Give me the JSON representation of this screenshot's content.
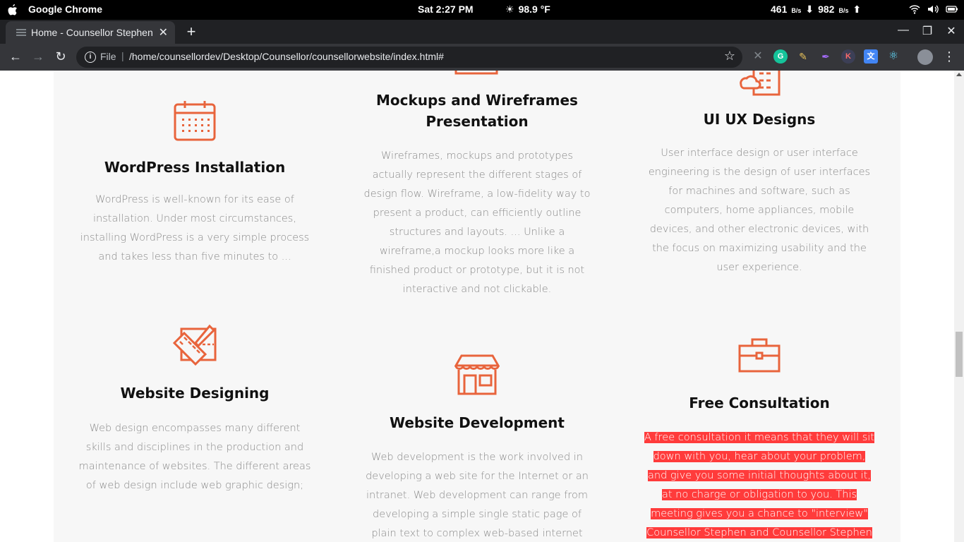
{
  "os": {
    "app_name": "Google Chrome",
    "clock": "Sat  2:27 PM",
    "weather": "98.9 °F",
    "net_down": "461",
    "net_down_unit": "B/s",
    "net_up": "982",
    "net_up_unit": "B/s"
  },
  "browser": {
    "tab_title": "Home - Counsellor Stephen",
    "new_tab": "+",
    "scheme": "File",
    "url": "/home/counsellordev/Desktop/Counsellor/counsellorwebsite/index.html#"
  },
  "colors": {
    "accent": "#e8643c",
    "highlight": "#ff3b3b"
  },
  "services": [
    {
      "title": "WordPress Installation",
      "icon": "calendar-icon",
      "text": "WordPress is well-known for its ease of installation. Under most circumstances, installing WordPress is a very simple process and takes less than five minutes to ..."
    },
    {
      "title": "Mockups and Wireframes Presentation",
      "icon": "wireframe-icon",
      "text": "Wireframes, mockups and prototypes actually represent the different stages of design flow. Wireframe, a low-fidelity way to present a product, can efficiently outline structures and layouts. ... Unlike a wireframe,a mockup looks more like a finished product or prototype, but it is not interactive and not clickable."
    },
    {
      "title": "UI UX Designs",
      "icon": "cloud-building-icon",
      "text": "User interface design or user interface engineering is the design of user interfaces for machines and software, such as computers, home appliances, mobile devices, and other electronic devices, with the focus on maximizing usability and the user experience."
    },
    {
      "title": "Website Designing",
      "icon": "design-tools-icon",
      "text": "Web design encompasses many different skills and disciplines in the production and maintenance of websites. The different areas of web design include web graphic design;"
    },
    {
      "title": "Website Development",
      "icon": "storefront-icon",
      "text": "Web development is the work involved in developing a web site for the Internet or an intranet. Web development can range from developing a simple single static page of plain text to complex web-based internet"
    },
    {
      "title": "Free Consultation",
      "icon": "briefcase-icon",
      "text": "A free consultation it means that they will sit down with you, hear about your problem, and give you some initial thoughts about it, at no charge or obligation to you. This meeting gives you a chance to \"interview\" Counsellor Stephen and Counsellor Stephen"
    }
  ]
}
